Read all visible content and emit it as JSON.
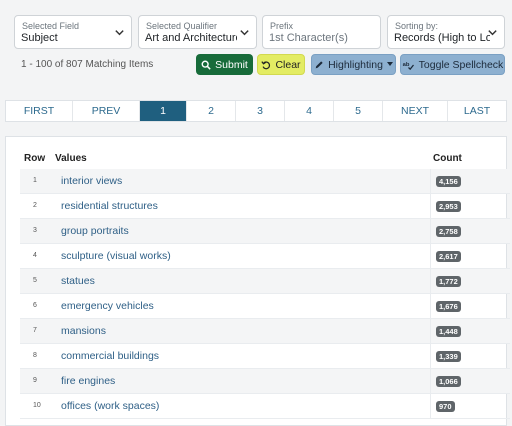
{
  "filters": {
    "selected_field": {
      "label": "Selected Field",
      "value": "Subject"
    },
    "selected_qualifier": {
      "label": "Selected Qualifier",
      "value": "Art and Architecture T"
    },
    "prefix": {
      "label": "Prefix",
      "placeholder": "1st Character(s)"
    },
    "sorting": {
      "label": "Sorting by:",
      "value": "Records (High to Low"
    }
  },
  "result_count": "1 - 100 of 807 Matching Items",
  "buttons": {
    "submit": "Submit",
    "clear": "Clear",
    "highlighting": "Highlighting",
    "spellcheck": "Toggle Spellcheck"
  },
  "pagination": [
    "FIRST",
    "PREV",
    "1",
    "2",
    "3",
    "4",
    "5",
    "NEXT",
    "LAST"
  ],
  "active_page": "1",
  "table": {
    "headers": {
      "row": "Row",
      "values": "Values",
      "count": "Count"
    },
    "rows": [
      {
        "row": "1",
        "value": "interior views",
        "count": "4,156"
      },
      {
        "row": "2",
        "value": "residential structures",
        "count": "2,953"
      },
      {
        "row": "3",
        "value": "group portraits",
        "count": "2,758"
      },
      {
        "row": "4",
        "value": "sculpture (visual works)",
        "count": "2,617"
      },
      {
        "row": "5",
        "value": "statues",
        "count": "1,772"
      },
      {
        "row": "6",
        "value": "emergency vehicles",
        "count": "1,676"
      },
      {
        "row": "7",
        "value": "mansions",
        "count": "1,448"
      },
      {
        "row": "8",
        "value": "commercial buildings",
        "count": "1,339"
      },
      {
        "row": "9",
        "value": "fire engines",
        "count": "1,066"
      },
      {
        "row": "10",
        "value": "offices (work spaces)",
        "count": "970"
      }
    ]
  },
  "colors": {
    "submit": "#176b3a",
    "clear": "#e3ec63",
    "toggle": "#8db0d0",
    "active_page": "#1f5f7f",
    "badge": "#5f6569",
    "link": "#2e5f86"
  }
}
